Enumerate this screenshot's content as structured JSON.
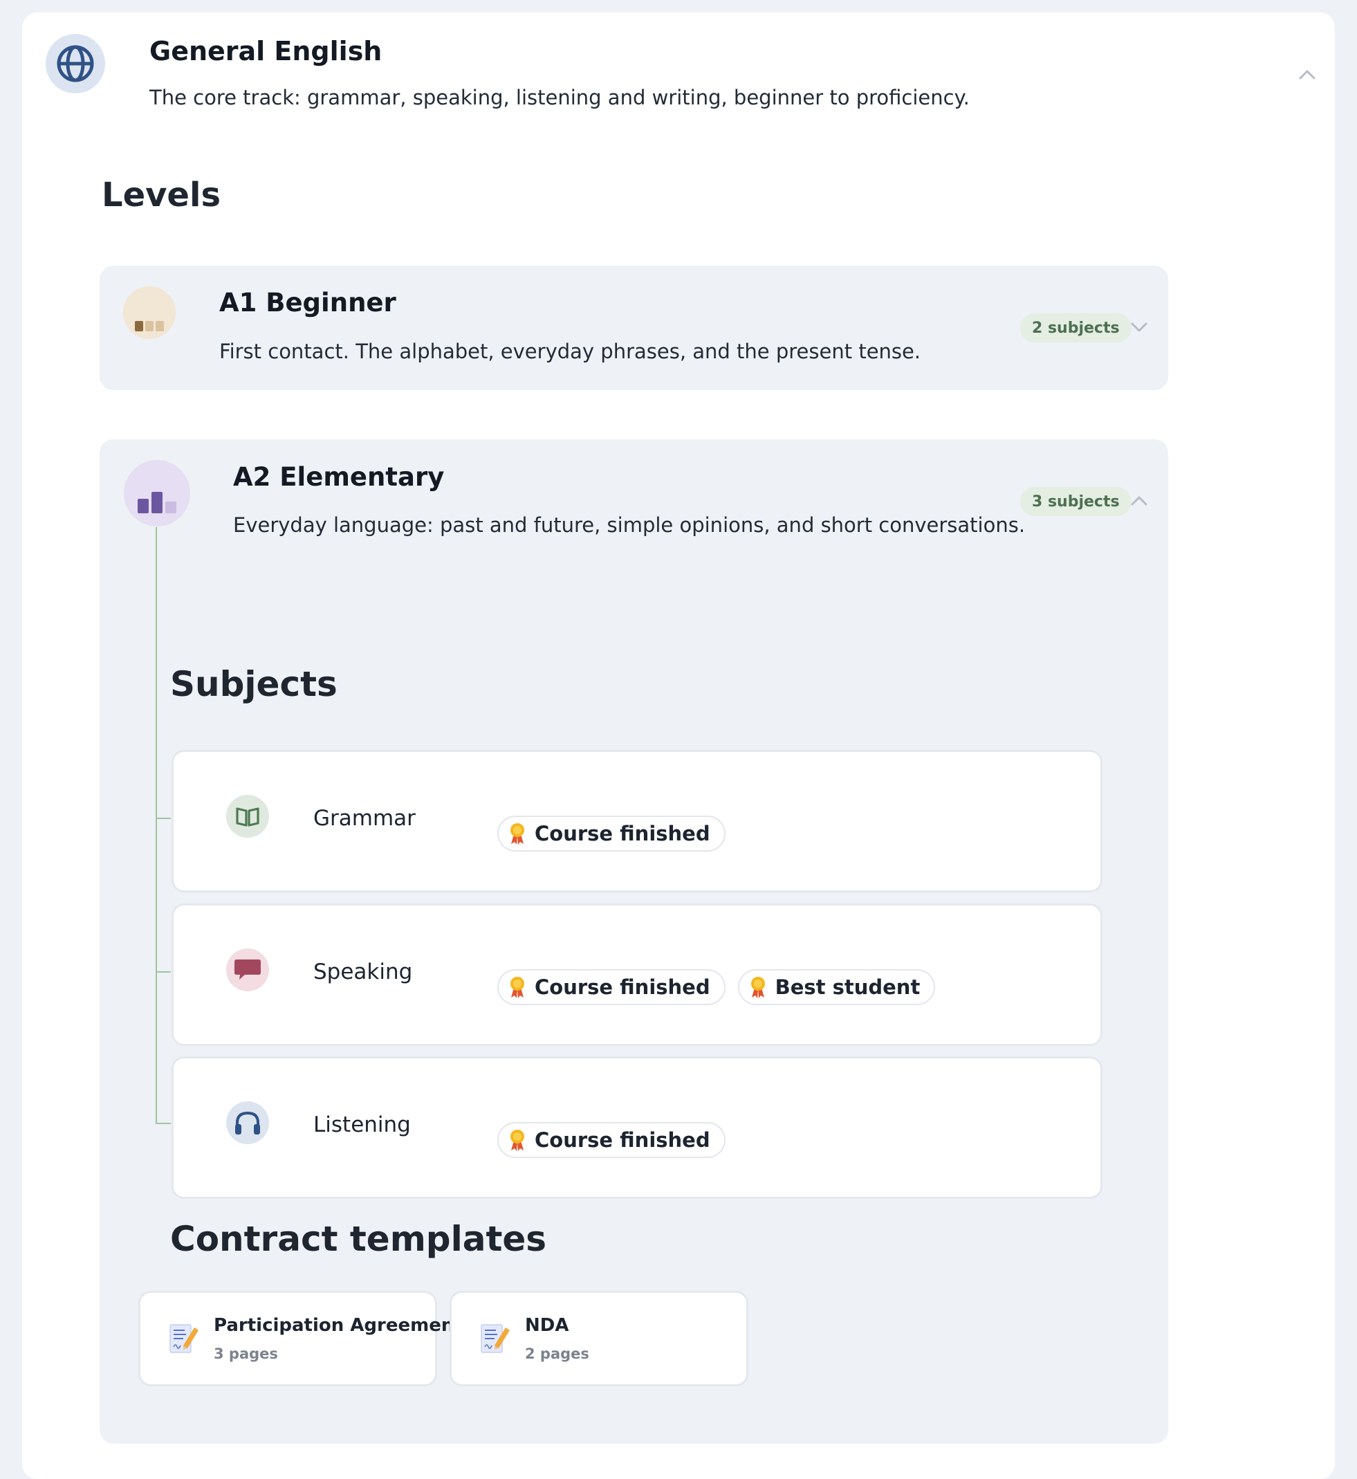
{
  "course": {
    "title": "General English",
    "description": "The core track: grammar, speaking, listening and writing, beginner to proficiency.",
    "icon": "globe-icon"
  },
  "levels_heading": "Levels",
  "levels": [
    {
      "title": "A1 Beginner",
      "description": "First contact. The alphabet, everyday phrases, and the present tense.",
      "count_label": "2 subjects",
      "expanded": false
    },
    {
      "title": "A2 Elementary",
      "description": "Everyday language: past and future, simple opinions, and short conversations.",
      "count_label": "3 subjects",
      "expanded": true
    }
  ],
  "subjects_heading": "Subjects",
  "subjects": [
    {
      "name": "Grammar",
      "icon": "book-icon",
      "badges": [
        "Course finished"
      ]
    },
    {
      "name": "Speaking",
      "icon": "speech-bubble-icon",
      "badges": [
        "Course finished",
        "Best student"
      ]
    },
    {
      "name": "Listening",
      "icon": "headphones-icon",
      "badges": [
        "Course finished"
      ]
    }
  ],
  "contracts_heading": "Contract templates",
  "contracts": [
    {
      "name": "Participation Agreement",
      "pages": "3 pages"
    },
    {
      "name": "NDA",
      "pages": "2 pages"
    }
  ],
  "colors": {
    "background": "#eef1f6",
    "count_pill_bg": "#e4eee2",
    "count_pill_text": "#4d7050",
    "tree_line": "#9fc49f"
  }
}
